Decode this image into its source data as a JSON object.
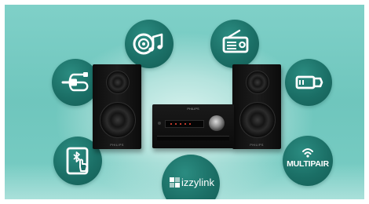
{
  "scene": {
    "background": "#79cdc4",
    "bubble_color": "#1b6f66"
  },
  "icons": {
    "music_cd": "music-cd-icon",
    "radio": "radio-icon",
    "audio_cable": "audio-cable-icon",
    "usb": "usb-icon",
    "bluetooth_tablet": "bluetooth-tablet-icon",
    "izzylink": "izzylink-logo",
    "multipair": "multipair-logo"
  },
  "badges": {
    "izzylink": "izzylink",
    "multipair": "MULTIPAIR"
  },
  "product": {
    "brand": "PHILIPS"
  }
}
